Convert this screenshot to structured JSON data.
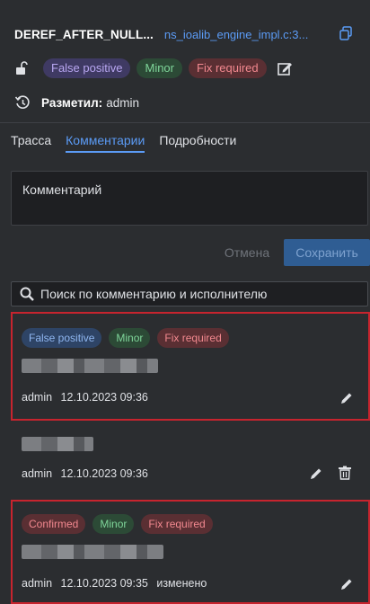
{
  "header": {
    "title": "DEREF_AFTER_NULL...",
    "file": "ns_ioalib_engine_impl.c:3...",
    "tags": [
      "False positive",
      "Minor",
      "Fix required"
    ],
    "marked_label": "Разметил:",
    "marked_user": "admin"
  },
  "tabs": [
    "Трасса",
    "Комментарии",
    "Подробности"
  ],
  "active_tab": "Комментарии",
  "comment_input": {
    "placeholder": "Комментарий"
  },
  "buttons": {
    "cancel": "Отмена",
    "save": "Сохранить"
  },
  "search": {
    "placeholder": "Поиск по комментарию и исполнителю"
  },
  "comments": [
    {
      "tags": [
        "False positive",
        "Minor",
        "Fix required"
      ],
      "author": "admin",
      "date": "12.10.2023 09:36",
      "edited": ""
    },
    {
      "tags": [],
      "author": "admin",
      "date": "12.10.2023 09:36",
      "edited": ""
    },
    {
      "tags": [
        "Confirmed",
        "Minor",
        "Fix required"
      ],
      "author": "admin",
      "date": "12.10.2023 09:35",
      "edited": "изменено"
    }
  ],
  "colors": {
    "accent": "#5b9bf5",
    "selected_border": "#c7242e",
    "background": "#2b2d30"
  }
}
